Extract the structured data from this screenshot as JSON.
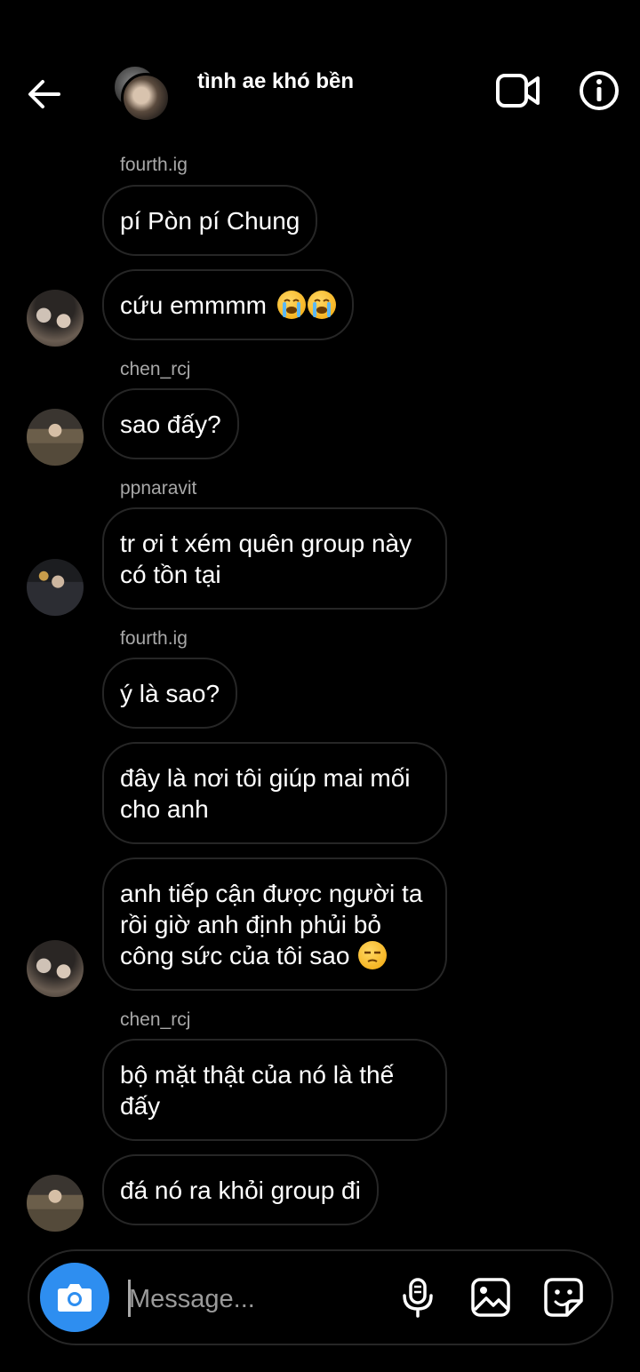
{
  "header": {
    "title": "tình ae khó bền",
    "back_icon": "arrow-left-icon",
    "video_icon": "video-camera-icon",
    "info_icon": "info-icon"
  },
  "messages": [
    {
      "sender": "fourth.ig",
      "text": "pí Pòn pí Chung"
    },
    {
      "text": "cứu emmmm",
      "emoji": [
        "loudly-crying-face",
        "loudly-crying-face"
      ]
    },
    {
      "sender": "chen_rcj",
      "text": "sao đấy?"
    },
    {
      "sender": "ppnaravit",
      "text": "tr ơi t xém quên group này có tồn tại"
    },
    {
      "sender": "fourth.ig",
      "text": "ý là sao?"
    },
    {
      "text": "đây là nơi tôi giúp mai mối cho anh"
    },
    {
      "text": "anh tiếp cận được người ta rồi giờ anh định phủi bỏ công sức của tôi sao",
      "emoji": [
        "unamused-face"
      ]
    },
    {
      "sender": "chen_rcj",
      "text": "bộ mặt thật của nó là thế đấy"
    },
    {
      "text": "đá nó ra khỏi group đi"
    }
  ],
  "composer": {
    "placeholder": "Message...",
    "value": "",
    "camera_icon": "camera-icon",
    "mic_icon": "microphone-icon",
    "gallery_icon": "image-gallery-icon",
    "sticker_icon": "sticker-icon"
  },
  "colors": {
    "background": "#000000",
    "bubble_border": "#262626",
    "sender_text": "#a8a8a8",
    "camera_button": "#2e8ef0"
  }
}
